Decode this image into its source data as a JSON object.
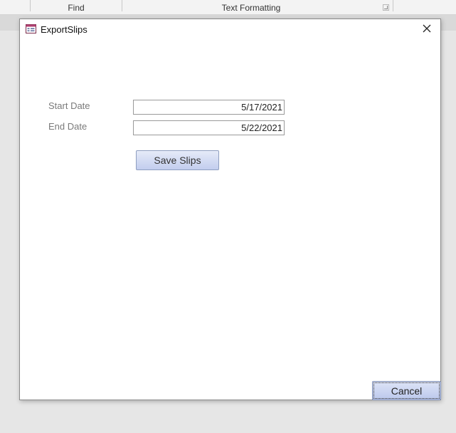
{
  "ribbon": {
    "groups": [
      {
        "label": "Find"
      },
      {
        "label": "Text Formatting"
      }
    ]
  },
  "dialog": {
    "title": "ExportSlips",
    "icon": "form-icon",
    "close_icon": "close-icon"
  },
  "form": {
    "start_date": {
      "label": "Start Date",
      "value": "5/17/2021"
    },
    "end_date": {
      "label": "End Date",
      "value": "5/22/2021"
    },
    "save_label": "Save Slips",
    "cancel_label": "Cancel"
  }
}
